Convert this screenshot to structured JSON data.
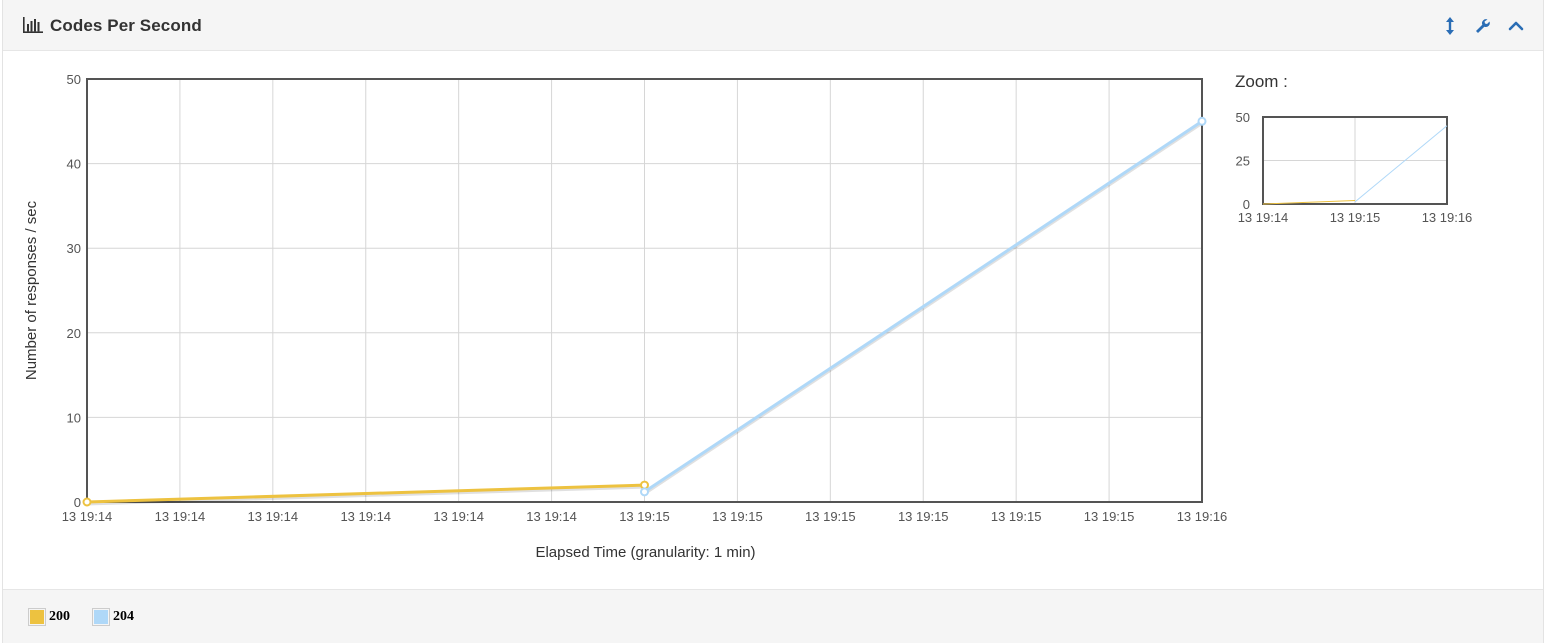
{
  "panel": {
    "title": "Codes Per Second",
    "icons": [
      "bar-chart-icon",
      "resize-vertical-icon",
      "wrench-icon",
      "chevron-up-icon"
    ],
    "accent_color": "#2a6db5"
  },
  "zoom": {
    "title": "Zoom :",
    "ylim": [
      0,
      50
    ],
    "y_ticks": [
      "0",
      "25",
      "50"
    ],
    "x_ticks": [
      "13 19:14",
      "13 19:15",
      "13 19:16"
    ]
  },
  "legend": [
    {
      "label": "200",
      "color": "#edc240"
    },
    {
      "label": "204",
      "color": "#afd8f8"
    }
  ],
  "chart_data": {
    "type": "line",
    "title": "",
    "xlabel": "Elapsed Time (granularity: 1 min)",
    "ylabel": "Number of responses / sec",
    "ylim": [
      0,
      50
    ],
    "y_ticks": [
      "0",
      "10",
      "20",
      "30",
      "40",
      "50"
    ],
    "x_ticks": [
      "13 19:14",
      "13 19:14",
      "13 19:14",
      "13 19:14",
      "13 19:14",
      "13 19:14",
      "13 19:15",
      "13 19:15",
      "13 19:15",
      "13 19:15",
      "13 19:15",
      "13 19:15",
      "13 19:16"
    ],
    "x_range": [
      "13 19:14",
      "13 19:16"
    ],
    "grid": true,
    "legend_position": "bottom-left",
    "series": [
      {
        "name": "200",
        "color": "#edc240",
        "x": [
          "13 19:14",
          "13 19:15"
        ],
        "values": [
          0,
          2
        ]
      },
      {
        "name": "204",
        "color": "#afd8f8",
        "x": [
          "13 19:15",
          "13 19:16"
        ],
        "values": [
          1.2,
          45
        ]
      }
    ]
  }
}
